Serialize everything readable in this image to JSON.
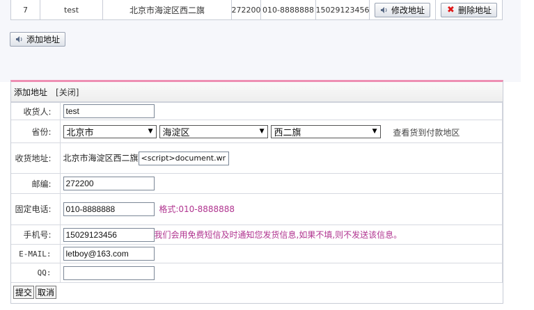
{
  "address_row": {
    "index": "7",
    "name": "test",
    "address": "北京市海淀区西二旗",
    "zip": "272200",
    "phone": "010-8888888",
    "mobile": "15029123456",
    "edit_label": "修改地址",
    "delete_label": "删除地址"
  },
  "add_address_label": "添加地址",
  "form": {
    "title": "添加地址",
    "close_label": "[关闭]",
    "fields": {
      "consignee": {
        "label": "收货人:",
        "value": "test"
      },
      "province": {
        "label": "省份:",
        "province_value": "北京市",
        "city_value": "海淀区",
        "district_value": "西二旗",
        "cod_link": "查看货到付款地区"
      },
      "address": {
        "label": "收货地址:",
        "prefix": "北京市海淀区西二旗",
        "value": "<script>document.write"
      },
      "zip": {
        "label": "邮编:",
        "value": "272200"
      },
      "phone": {
        "label": "固定电话:",
        "value": "010-8888888",
        "hint": "格式:010-8888888"
      },
      "mobile": {
        "label": "手机号:",
        "value": "15029123456",
        "hint": "我们会用免费短信及时通知您发货信息,如果不填,则不发送该信息。"
      },
      "email": {
        "label": "E-MAIL:",
        "value": "letboy@163.com"
      },
      "qq": {
        "label": "QQ:",
        "value": ""
      }
    },
    "submit_label": "提交",
    "cancel_label": "取消"
  },
  "colors": {
    "accent_top_border": "#ee8fb3",
    "hint_text": "#b0338f",
    "delete_icon": "#e01818"
  }
}
